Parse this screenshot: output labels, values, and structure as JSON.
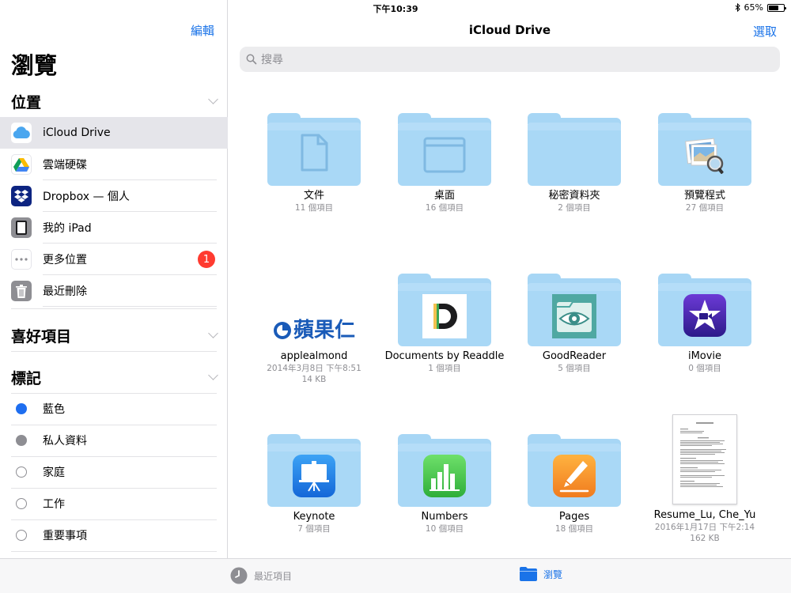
{
  "status_bar": {
    "device": "iPad",
    "time": "下午10:39",
    "battery": "65%",
    "battery_level": 0.65
  },
  "sidebar": {
    "edit_label": "編輯",
    "title": "瀏覽",
    "sections": {
      "locations": "位置",
      "favorites": "喜好項目",
      "tags": "標記"
    },
    "locations": [
      {
        "label": "iCloud Drive",
        "icon": "icloud-icon"
      },
      {
        "label": "雲端硬碟",
        "icon": "google-drive-icon"
      },
      {
        "label": "Dropbox — 個人",
        "icon": "dropbox-icon"
      },
      {
        "label": "我的 iPad",
        "icon": "ipad-icon"
      },
      {
        "label": "更多位置",
        "icon": "more-icon",
        "badge": "1"
      },
      {
        "label": "最近刪除",
        "icon": "trash-icon"
      }
    ],
    "tags": [
      {
        "label": "藍色",
        "color": "#1e6ef0"
      },
      {
        "label": "私人資料",
        "color": "#8e8e93"
      },
      {
        "label": "家庭",
        "color": ""
      },
      {
        "label": "工作",
        "color": ""
      },
      {
        "label": "重要事項",
        "color": ""
      }
    ]
  },
  "main": {
    "title": "iCloud Drive",
    "select_label": "選取",
    "search_placeholder": "搜尋",
    "items": [
      {
        "name": "文件",
        "meta": "11 個項目",
        "kind": "folder",
        "icon": "document-icon"
      },
      {
        "name": "桌面",
        "meta": "16 個項目",
        "kind": "folder",
        "icon": "desktop-window-icon"
      },
      {
        "name": "秘密資料夾",
        "meta": "2 個項目",
        "kind": "folder",
        "icon": ""
      },
      {
        "name": "預覽程式",
        "meta": "27 個項目",
        "kind": "folder",
        "icon": "preview-app-icon"
      },
      {
        "name": "applealmond",
        "meta": "2014年3月8日 下午8:51",
        "meta2": "14 KB",
        "kind": "image",
        "logo_text": "蘋果仁",
        "icon": "applealmond-logo-icon"
      },
      {
        "name": "Documents by Readdle",
        "meta": "1 個項目",
        "kind": "folder",
        "icon": "documents-readdle-icon"
      },
      {
        "name": "GoodReader",
        "meta": "5 個項目",
        "kind": "folder",
        "icon": "goodreader-icon"
      },
      {
        "name": "iMovie",
        "meta": "0 個項目",
        "kind": "folder",
        "icon": "imovie-icon"
      },
      {
        "name": "Keynote",
        "meta": "7 個項目",
        "kind": "folder",
        "icon": "keynote-icon"
      },
      {
        "name": "Numbers",
        "meta": "10 個項目",
        "kind": "folder",
        "icon": "numbers-icon"
      },
      {
        "name": "Pages",
        "meta": "18 個項目",
        "kind": "folder",
        "icon": "pages-icon"
      },
      {
        "name": "Resume_Lu, Che_Yu",
        "meta": "2016年1月17日 下午2:14",
        "meta2": "162 KB",
        "kind": "document",
        "icon": "resume-document-icon"
      }
    ]
  },
  "tabbar": {
    "recent_label": "最近項目",
    "browse_label": "瀏覽",
    "accent": "#1a73e8"
  }
}
